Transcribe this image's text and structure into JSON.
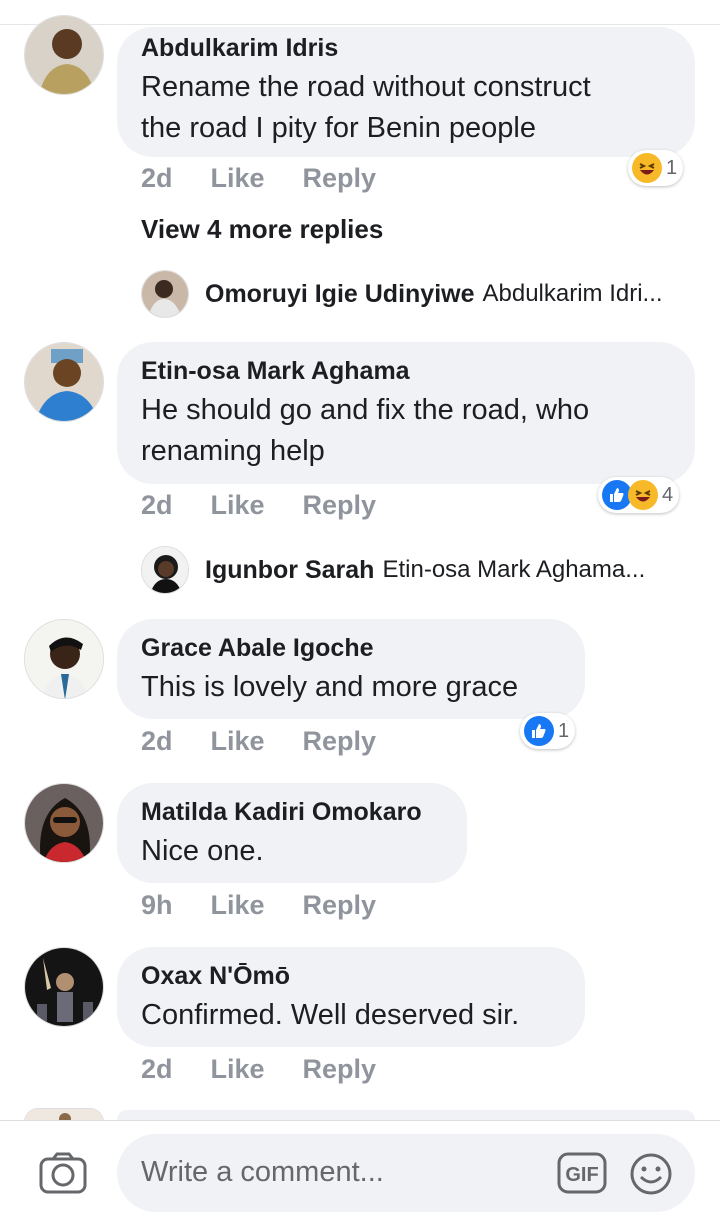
{
  "comments": [
    {
      "name": "Abdulkarim Idris",
      "text_lines": [
        "Rename the road without construct",
        "the road I pity for Benin people"
      ],
      "time": "2d",
      "like": "Like",
      "reply": "Reply",
      "reaction_count": "1"
    },
    {
      "name": "Etin-osa Mark Aghama",
      "text_lines": [
        "He should go and fix the road, who",
        "renaming help"
      ],
      "time": "2d",
      "like": "Like",
      "reply": "Reply",
      "reaction_count": "4"
    },
    {
      "name": "Grace Abale Igoche",
      "text_lines": [
        "This is lovely and more grace"
      ],
      "time": "2d",
      "like": "Like",
      "reply": "Reply",
      "reaction_count": "1"
    },
    {
      "name": "Matilda Kadiri Omokaro",
      "text_lines": [
        "Nice one."
      ],
      "time": "9h",
      "like": "Like",
      "reply": "Reply"
    },
    {
      "name": "Oxax N'Ōmō",
      "text_lines": [
        "Confirmed. Well deserved sir."
      ],
      "time": "2d",
      "like": "Like",
      "reply": "Reply"
    }
  ],
  "view_more_replies": "View 4 more replies",
  "replies": [
    {
      "name": "Omoruyi Igie Udinyiwe",
      "text": "Abdulkarim Idri..."
    },
    {
      "name": "Igunbor Sarah",
      "text": "Etin-osa Mark Aghama..."
    }
  ],
  "composer": {
    "placeholder": "Write a comment...",
    "camera_icon": "camera-icon",
    "gif_icon": "gif-icon",
    "emoji_icon": "smiley-icon"
  },
  "colors": {
    "bubble": "#f0f2f5",
    "meta": "#90949c",
    "like_blue": "#1877f2",
    "haha_yellow": "#f7b928"
  }
}
